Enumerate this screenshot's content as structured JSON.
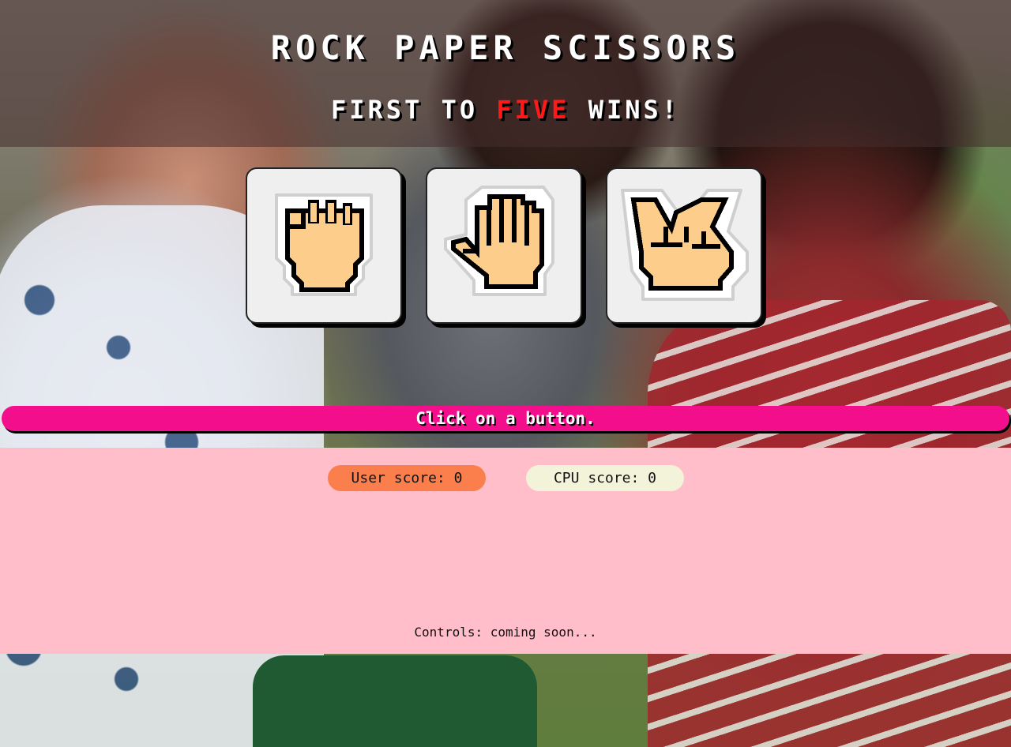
{
  "header": {
    "title": "ROCK PAPER SCISSORS",
    "subtitle_prefix": "FIRST TO",
    "subtitle_accent": "FIVE",
    "subtitle_suffix": "WINS!",
    "accent_color": "#ff1a1a"
  },
  "choices": [
    {
      "id": "rock",
      "icon": "rock-hand-icon"
    },
    {
      "id": "paper",
      "icon": "paper-hand-icon"
    },
    {
      "id": "scissors",
      "icon": "scissors-hand-icon"
    }
  ],
  "message": {
    "text": "Click on a button.",
    "color": "#f30e8b"
  },
  "scores": {
    "user_label": "User score: 0",
    "cpu_label": "CPU score: 0",
    "user_color": "#fa7f4d",
    "cpu_color": "#f2f3d9"
  },
  "footer": {
    "controls_text": "Controls: coming soon...",
    "panel_color": "#ffbec9"
  }
}
